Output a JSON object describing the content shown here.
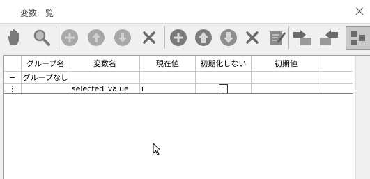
{
  "window": {
    "title": "変数一覧",
    "close_icon": "×"
  },
  "toolbar": {
    "buttons": [
      {
        "icon": "hand-icon"
      },
      {
        "icon": "search-icon"
      },
      {
        "icon": "circle-left-icon"
      },
      {
        "icon": "circle-up-icon"
      },
      {
        "icon": "circle-down-icon"
      },
      {
        "icon": "close-x-icon"
      },
      {
        "icon": "circle-plus-icon"
      },
      {
        "icon": "circle-up-icon"
      },
      {
        "icon": "circle-down-icon"
      },
      {
        "icon": "close-x-icon"
      },
      {
        "icon": "edit-icon"
      },
      {
        "icon": "move-right-icon"
      },
      {
        "icon": "move-left-icon"
      },
      {
        "icon": "layout-icon"
      }
    ]
  },
  "grid": {
    "columns": [
      "",
      "グループ名",
      "変数名",
      "現在値",
      "初期化しない",
      "初期値",
      ""
    ],
    "rows": [
      {
        "marker": "−",
        "group": "グループなし",
        "name": "",
        "value": "",
        "no_init": false,
        "init": ""
      },
      {
        "marker": "⋮",
        "group": "",
        "name": "selected_value",
        "value": "i",
        "no_init": false,
        "init": ""
      }
    ]
  }
}
